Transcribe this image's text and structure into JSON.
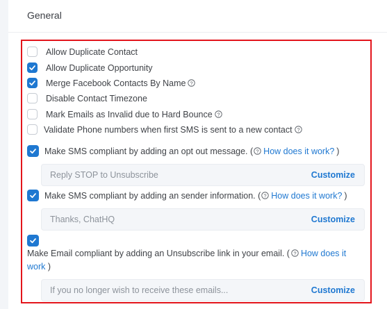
{
  "section": {
    "title": "General"
  },
  "options": [
    {
      "label": "Allow Duplicate Contact",
      "checked": false
    },
    {
      "label": "Allow Duplicate Opportunity",
      "checked": true
    },
    {
      "label": "Merge Facebook Contacts By Name",
      "checked": true,
      "help": true
    },
    {
      "label": "Disable Contact Timezone",
      "checked": false
    },
    {
      "label": "Mark Emails as Invalid due to Hard Bounce",
      "checked": false,
      "help": true
    },
    {
      "label": "Validate Phone numbers when first SMS is sent to a new contact",
      "checked": false,
      "help": true
    }
  ],
  "sms_optout": {
    "checked": true,
    "label": "Make SMS compliant by adding an opt out message. (",
    "link": "How does it work?",
    "close": ")",
    "placeholder": "Reply STOP to Unsubscribe",
    "button": "Customize"
  },
  "sms_sender": {
    "checked": true,
    "label": "Make SMS compliant by adding an sender information. (",
    "link": "How does it work?",
    "close": ")",
    "placeholder": "Thanks, ChatHQ",
    "button": "Customize"
  },
  "email_unsub": {
    "checked": true,
    "label": "Make Email compliant by adding an Unsubscribe link in your email. (",
    "link": "How does it work",
    "close": ")",
    "placeholder": "If you no longer wish to receive these emails...",
    "button": "Customize"
  },
  "colors": {
    "accent": "#1f78d1",
    "highlight": "#e3141b"
  }
}
